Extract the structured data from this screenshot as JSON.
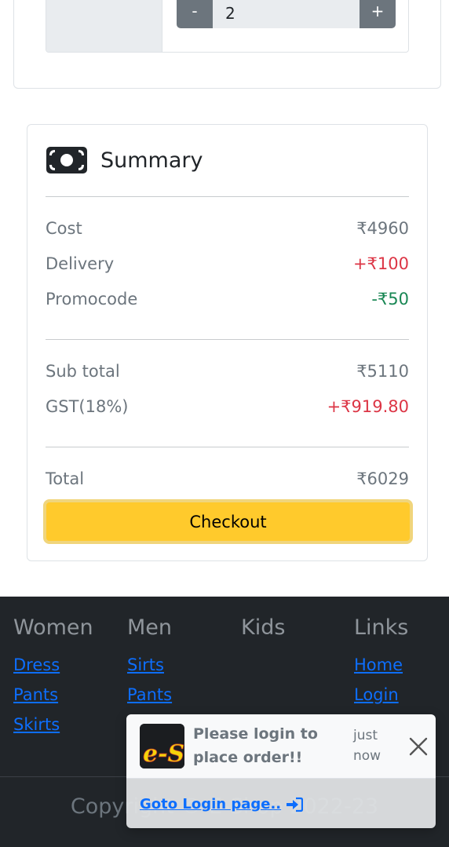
{
  "cart": {
    "quantity": "2",
    "minus_label": "-",
    "plus_label": "+"
  },
  "summary": {
    "icon": "money-bill-icon",
    "title": "Summary",
    "cost_label": "Cost",
    "cost_value": "₹4960",
    "delivery_label": "Delivery",
    "delivery_value": "+₹100",
    "promo_label": "Promocode",
    "promo_value": "-₹50",
    "subtotal_label": "Sub total",
    "subtotal_value": "₹5110",
    "gst_label": "GST(18%)",
    "gst_value": "+₹919.80",
    "total_label": "Total",
    "total_value": "₹6029",
    "checkout_label": "Checkout"
  },
  "footer": {
    "columns": [
      {
        "heading": "Women",
        "links": [
          "Dress",
          "Pants",
          "Skirts"
        ]
      },
      {
        "heading": "Men",
        "links": [
          "Sirts",
          "Pants"
        ]
      },
      {
        "heading": "Kids",
        "links": []
      },
      {
        "heading": "Links",
        "links": [
          "Home",
          "Login"
        ]
      }
    ],
    "copyright": "Copyright © E-Shop 2022-23"
  },
  "toast": {
    "logo_text": "e-S",
    "message": "Please login to place order!!",
    "time": "just now",
    "link_label": "Goto Login page..",
    "link_icon": "login-icon",
    "close_icon": "close-icon"
  },
  "colors": {
    "warning": "#ffc107",
    "danger": "#dc3545",
    "success": "#198754",
    "footer_bg": "#212529",
    "link": "#0d6efd"
  }
}
